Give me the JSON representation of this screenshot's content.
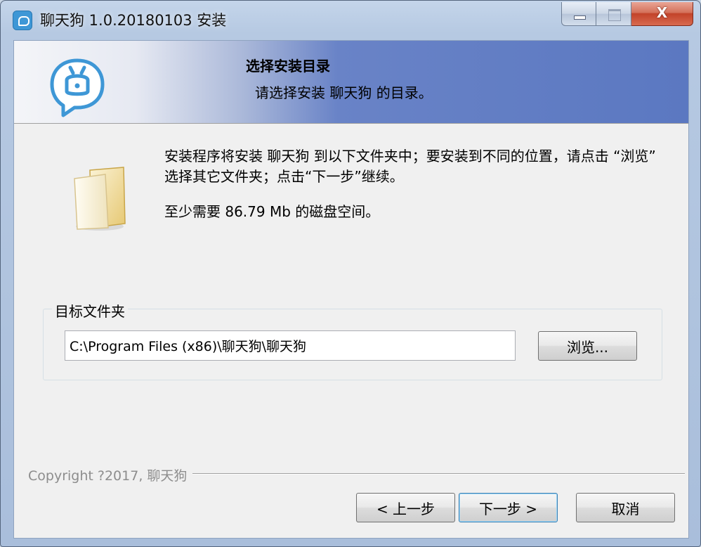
{
  "window": {
    "title": "聊天狗 1.0.20180103 安装",
    "close_glyph": "X"
  },
  "header": {
    "title": "选择安装目录",
    "subtitle": "请选择安装 聊天狗 的目录。"
  },
  "body": {
    "description": "安装程序将安装 聊天狗 到以下文件夹中；要安装到不同的位置，请点击 “浏览” 选择其它文件夹；点击“下一步”继续。",
    "space_required": "至少需要 86.79 Mb 的磁盘空间。"
  },
  "destination": {
    "group_label": "目标文件夹",
    "path": "C:\\Program Files (x86)\\聊天狗\\聊天狗",
    "browse_label": "浏览..."
  },
  "footer": {
    "copyright": "Copyright ?2017, 聊天狗",
    "back_label": "< 上一步",
    "next_label": "下一步 >",
    "cancel_label": "取消"
  },
  "icons": {
    "app": "chat-bubble-icon",
    "header": "chat-bubble-logo-icon",
    "folder": "folder-icon"
  },
  "colors": {
    "header_accent": "#5b78c1",
    "logo_blue": "#3e97d6",
    "close_red": "#c2432a",
    "copyright_gray": "#8d8d8d"
  }
}
